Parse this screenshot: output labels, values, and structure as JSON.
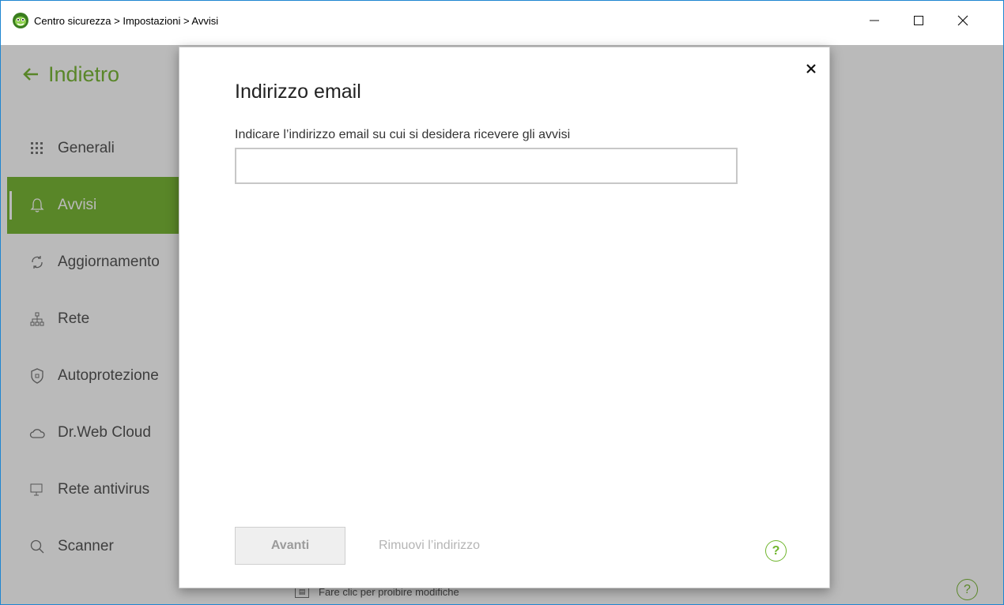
{
  "window": {
    "title": "Centro sicurezza > Impostazioni > Avvisi"
  },
  "app": {
    "back_label": "Indietro",
    "menu": [
      {
        "label": "Generali",
        "icon": "grid-icon"
      },
      {
        "label": "Avvisi",
        "icon": "bell-icon",
        "active": true
      },
      {
        "label": "Aggiornamento",
        "icon": "refresh-icon"
      },
      {
        "label": "Rete",
        "icon": "network-icon"
      },
      {
        "label": "Autoprotezione",
        "icon": "shield-icon"
      },
      {
        "label": "Dr.Web Cloud",
        "icon": "cloud-icon"
      },
      {
        "label": "Rete antivirus",
        "icon": "monitor-icon"
      },
      {
        "label": "Scanner",
        "icon": "search-icon"
      }
    ],
    "lock_hint": "Fare clic per proibire modifiche",
    "help_symbol": "?"
  },
  "dialog": {
    "title": "Indirizzo email",
    "label": "Indicare l’indirizzo email su cui si desidera ricevere gli avvisi",
    "email_value": "",
    "next_label": "Avanti",
    "remove_label": "Rimuovi l’indirizzo",
    "help_symbol": "?"
  },
  "colors": {
    "accent": "#7bb838",
    "window_border": "#1f86d1"
  }
}
